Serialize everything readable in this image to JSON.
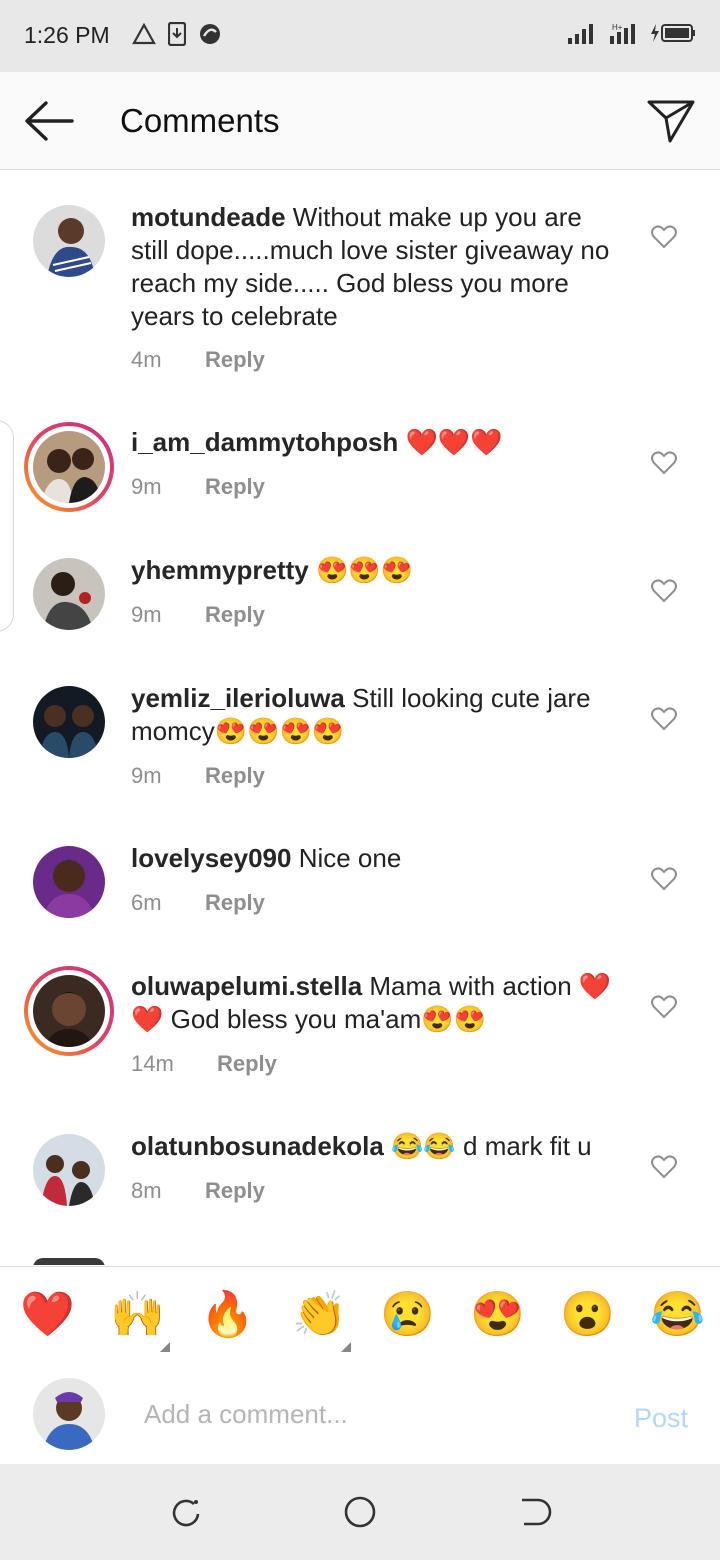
{
  "status_bar": {
    "time": "1:26 PM"
  },
  "header": {
    "title": "Comments"
  },
  "comments": [
    {
      "username": "motundeade",
      "text": " Without make up you are still dope.....much love sister giveaway no reach my side..... God bless you more years to celebrate",
      "time": "4m",
      "reply": "Reply"
    },
    {
      "username": "i_am_dammytohposh",
      "text": " ❤️❤️❤️",
      "time": "9m",
      "reply": "Reply"
    },
    {
      "username": "yhemmypretty",
      "text": " 😍😍😍",
      "time": "9m",
      "reply": "Reply"
    },
    {
      "username": "yemliz_ilerioluwa",
      "text": " Still looking cute jare momcy😍😍😍😍",
      "time": "9m",
      "reply": "Reply"
    },
    {
      "username": "lovelysey090",
      "text": " Nice one",
      "time": "6m",
      "reply": "Reply"
    },
    {
      "username": "oluwapelumi.stella",
      "text": " Mama with action ❤️❤️ God bless you ma'am😍😍",
      "time": "14m",
      "reply": "Reply"
    },
    {
      "username": "olatunbosunadekola",
      "text": " 😂😂 d mark fit u",
      "time": "8m",
      "reply": "Reply"
    }
  ],
  "emoji_bar": [
    "❤️",
    "🙌",
    "🔥",
    "👏",
    "😢",
    "😍",
    "😮",
    "😂"
  ],
  "composer": {
    "placeholder": "Add a comment...",
    "post_label": "Post"
  },
  "colors": {
    "post_disabled": "#b3d7f7",
    "story_ring": "#e4405f",
    "meta_gray": "#8e8e8e"
  }
}
